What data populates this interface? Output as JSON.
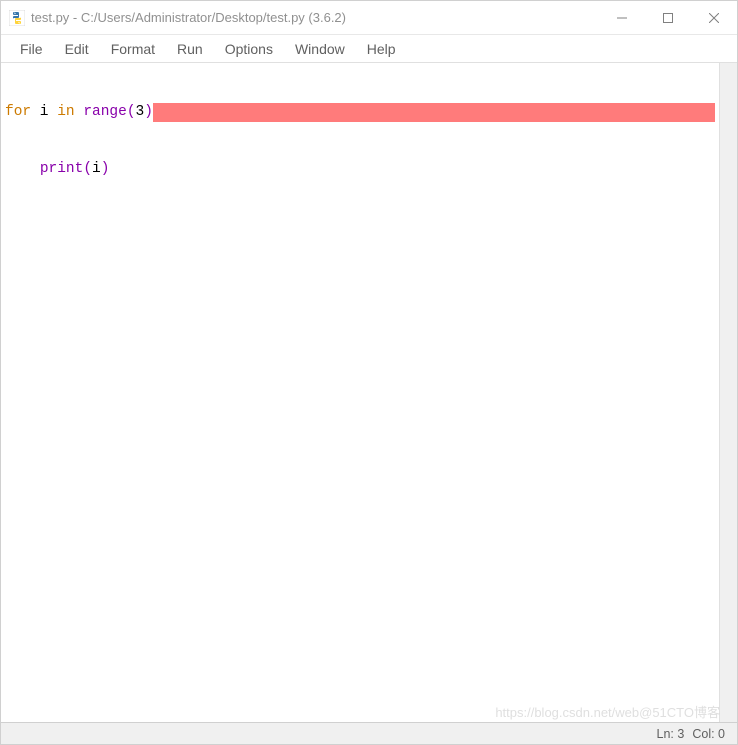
{
  "window": {
    "title": "test.py - C:/Users/Administrator/Desktop/test.py (3.6.2)"
  },
  "menu": {
    "items": [
      "File",
      "Edit",
      "Format",
      "Run",
      "Options",
      "Window",
      "Help"
    ]
  },
  "code": {
    "line1": {
      "kw_for": "for",
      "var": " i ",
      "kw_in": "in",
      "sp": " ",
      "func": "range",
      "open": "(",
      "arg": "3",
      "close": ")"
    },
    "line2": {
      "indent": "    ",
      "func": "print",
      "open": "(",
      "arg": "i",
      "close": ")"
    }
  },
  "status": {
    "line": "Ln: 3",
    "col": "Col: 0"
  },
  "watermark": "https://blog.csdn.net/web@51CTO博客"
}
